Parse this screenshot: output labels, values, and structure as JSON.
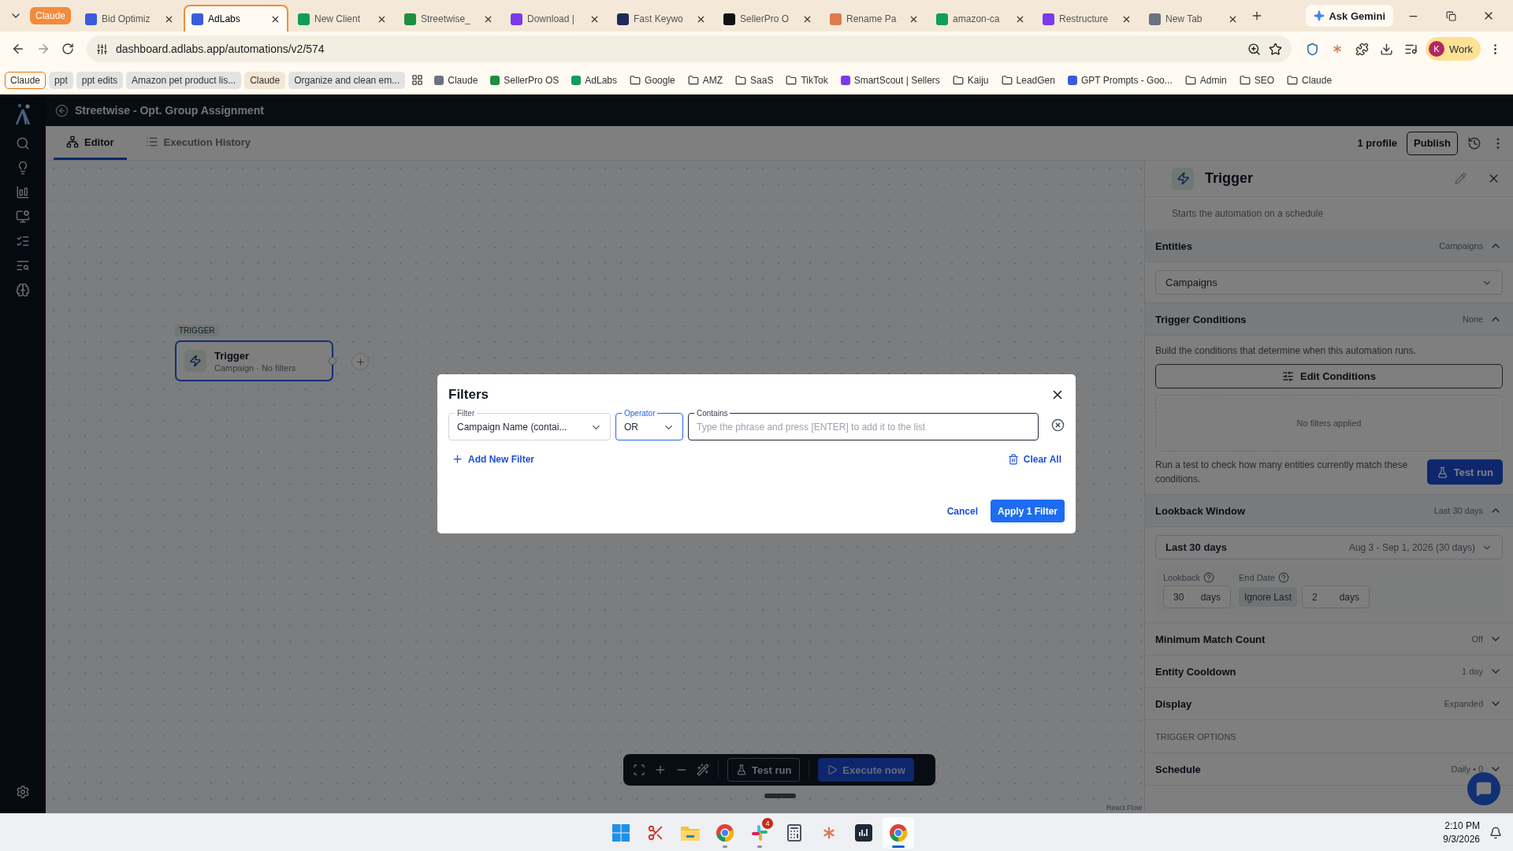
{
  "browser": {
    "tabs": [
      {
        "kind": "group",
        "title": "Claude",
        "color": "#f28b3c"
      },
      {
        "kind": "tab",
        "title": "Bid Optimiz",
        "selected": false
      },
      {
        "kind": "tab",
        "title": "AdLabs",
        "selected": true
      },
      {
        "kind": "tab",
        "title": "New Client",
        "selected": false
      },
      {
        "kind": "tab",
        "title": "Streetwise_",
        "selected": false
      },
      {
        "kind": "tab",
        "title": "Download |",
        "selected": false
      },
      {
        "kind": "tab",
        "title": "Fast Keywo",
        "selected": false
      },
      {
        "kind": "tab",
        "title": "SellerPro O",
        "selected": false
      },
      {
        "kind": "tab",
        "title": "Rename Pa",
        "selected": false
      },
      {
        "kind": "tab",
        "title": "amazon-ca",
        "selected": false
      },
      {
        "kind": "tab",
        "title": "Restructure",
        "selected": false
      },
      {
        "kind": "tab",
        "title": "New Tab",
        "selected": false
      }
    ],
    "ask": "Ask Gemini",
    "url": "dashboard.adlabs.app/automations/v2/574",
    "profile": {
      "initial": "K",
      "label": "Work"
    },
    "bookmarks": [
      {
        "kind": "group",
        "label": "Claude",
        "color": "#e8710a"
      },
      {
        "kind": "group",
        "label": "ppt",
        "color": "#e3e3e3"
      },
      {
        "kind": "group",
        "label": "ppt edits",
        "color": "#e3e3e3"
      },
      {
        "kind": "group",
        "label": "Amazon pet product lis...",
        "color": "#e3e3e3"
      },
      {
        "kind": "group",
        "label": "Claude",
        "color": "#f3e6d4"
      },
      {
        "kind": "group",
        "label": "Organize and clean em...",
        "color": "#e3e3e3"
      },
      {
        "kind": "apps"
      },
      {
        "kind": "page",
        "label": "Claude"
      },
      {
        "kind": "page",
        "label": "SellerPro OS"
      },
      {
        "kind": "page",
        "label": "AdLabs"
      },
      {
        "kind": "folder",
        "label": "Google"
      },
      {
        "kind": "folder",
        "label": "AMZ"
      },
      {
        "kind": "folder",
        "label": "SaaS"
      },
      {
        "kind": "folder",
        "label": "TikTok"
      },
      {
        "kind": "page",
        "label": "SmartScout | Sellers"
      },
      {
        "kind": "folder",
        "label": "Kaiju"
      },
      {
        "kind": "folder",
        "label": "LeadGen"
      },
      {
        "kind": "page",
        "label": "GPT Prompts - Goo..."
      },
      {
        "kind": "folder",
        "label": "Admin"
      },
      {
        "kind": "folder",
        "label": "SEO"
      },
      {
        "kind": "folder",
        "label": "Claude"
      }
    ]
  },
  "app": {
    "title": "Streetwise - Opt. Group Assignment",
    "tabs": [
      {
        "label": "Editor",
        "selected": true
      },
      {
        "label": "Execution History",
        "selected": false
      }
    ],
    "profiles": "1 profile",
    "publish": "Publish",
    "canvas": {
      "tag": "TRIGGER",
      "node_title": "Trigger",
      "node_subtitle": "Campaign · No filters",
      "test_run": "Test run",
      "execute": "Execute now",
      "attribution": "React Flow"
    },
    "panel": {
      "title": "Trigger",
      "description": "Starts the automation on a schedule",
      "sections": [
        {
          "kind": "entities",
          "title": "Entities",
          "summary": "Campaigns",
          "expanded": true,
          "select": "Campaigns"
        },
        {
          "kind": "conditions",
          "title": "Trigger Conditions",
          "summary": "None",
          "expanded": true,
          "text": "Build the conditions that determine when this automation runs.",
          "button": "Edit Conditions",
          "empty": "No filters applied",
          "test_text": "Run a test to check how many entities currently match these conditions.",
          "test_button": "Test run"
        },
        {
          "kind": "lookback",
          "title": "Lookback Window",
          "summary": "Last 30 days",
          "expanded": true,
          "preset": "Last 30 days",
          "range": "Aug 3 - Sep 1, 2026 (30 days)",
          "lookback_label": "Lookback",
          "lookback_value": "30",
          "lookback_unit": "days",
          "end_label": "End Date",
          "end_mode": "Ignore Last",
          "end_value": "2",
          "end_unit": "days"
        },
        {
          "kind": "plain",
          "title": "Minimum Match Count",
          "summary": "Off",
          "expanded": false
        },
        {
          "kind": "plain",
          "title": "Entity Cooldown",
          "summary": "1 day",
          "expanded": false
        },
        {
          "kind": "plain",
          "title": "Display",
          "summary": "Expanded",
          "expanded": false
        },
        {
          "kind": "heading",
          "title": "TRIGGER OPTIONS"
        },
        {
          "kind": "plain",
          "title": "Schedule",
          "summary": "Daily • 0",
          "expanded": false
        }
      ]
    }
  },
  "modal": {
    "title": "Filters",
    "filter": {
      "label": "Filter",
      "value": "Campaign Name (contai..."
    },
    "operator": {
      "label": "Operator",
      "value": "OR",
      "focused": true
    },
    "contains": {
      "label": "Contains",
      "placeholder": "Type the phrase and press [ENTER] to add it to the list"
    },
    "add": "Add New Filter",
    "clear": "Clear All",
    "cancel": "Cancel",
    "apply": "Apply 1 Filter"
  },
  "taskbar": {
    "apps": [
      {
        "kind": "windows",
        "running": false,
        "selected": false
      },
      {
        "kind": "snip",
        "running": false,
        "selected": false
      },
      {
        "kind": "files",
        "running": false,
        "selected": false
      },
      {
        "kind": "chrome",
        "running": true,
        "selected": false
      },
      {
        "kind": "slack",
        "running": true,
        "selected": false,
        "badge": "4"
      },
      {
        "kind": "calculator",
        "running": false,
        "selected": false
      },
      {
        "kind": "claude",
        "running": false,
        "selected": false
      },
      {
        "kind": "meter",
        "running": false,
        "selected": false
      },
      {
        "kind": "chrome",
        "running": true,
        "selected": true
      }
    ],
    "time": "2:10 PM",
    "date": "9/3/2026"
  }
}
